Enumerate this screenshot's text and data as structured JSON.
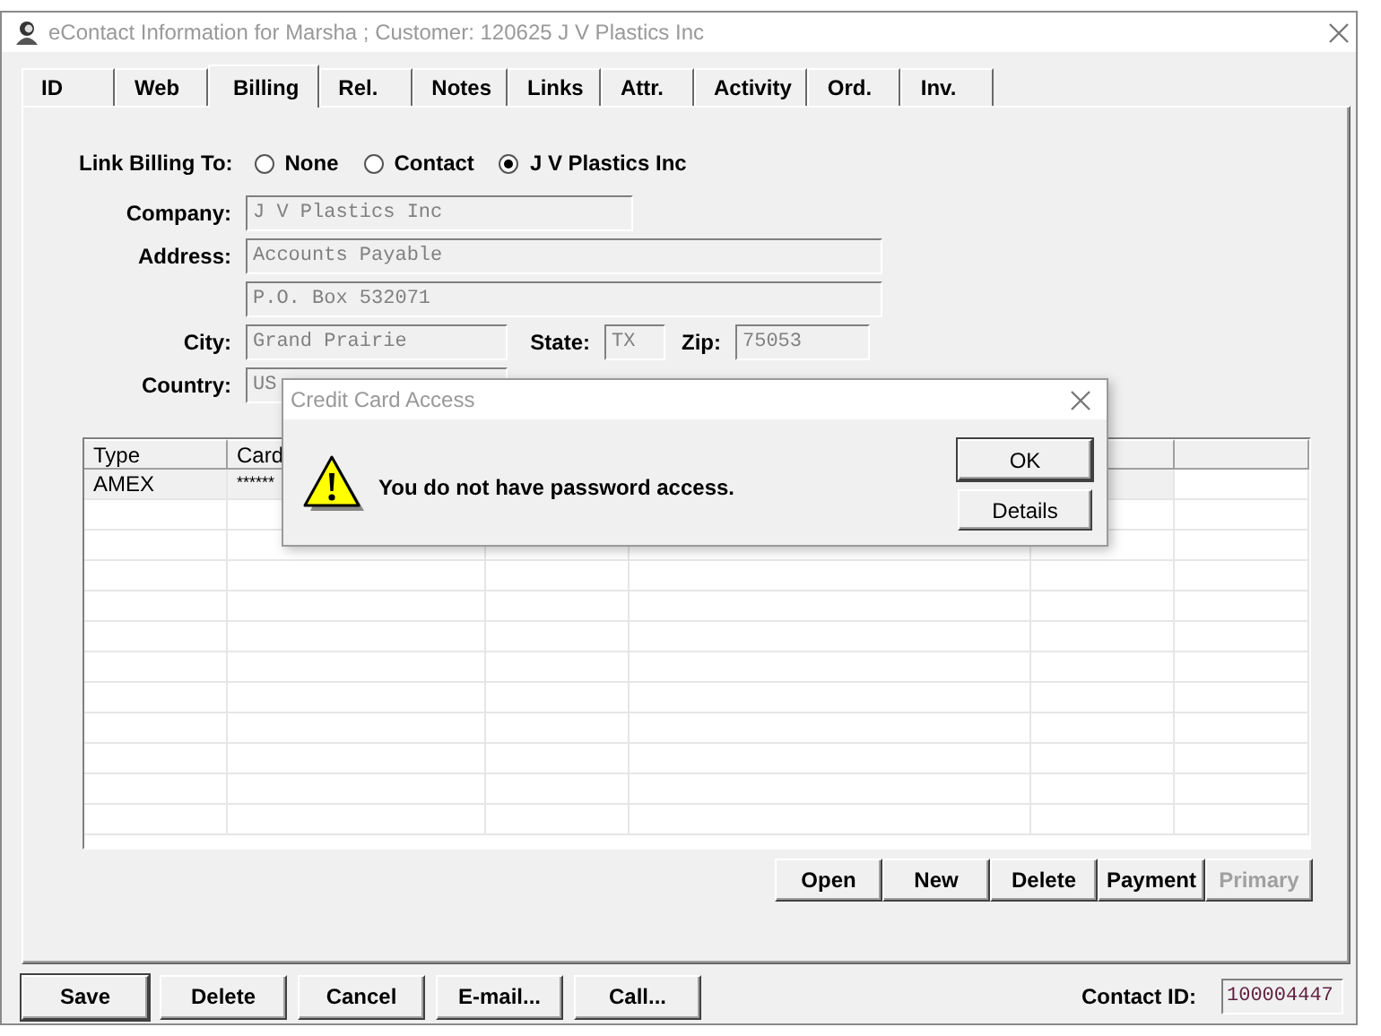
{
  "window": {
    "title": "eContact Information for Marsha ; Customer: 120625 J V Plastics Inc"
  },
  "tabs": [
    {
      "label": "ID",
      "selected": false
    },
    {
      "label": "Web",
      "selected": false
    },
    {
      "label": "Billing",
      "selected": true
    },
    {
      "label": "Rel.",
      "selected": false
    },
    {
      "label": "Notes",
      "selected": false
    },
    {
      "label": "Links",
      "selected": false
    },
    {
      "label": "Attr.",
      "selected": false
    },
    {
      "label": "Activity",
      "selected": false
    },
    {
      "label": "Ord.",
      "selected": false
    },
    {
      "label": "Inv.",
      "selected": false
    }
  ],
  "link_billing": {
    "label": "Link Billing To:",
    "options": [
      {
        "label": "None",
        "selected": false
      },
      {
        "label": "Contact",
        "selected": false
      },
      {
        "label": "J V Plastics Inc",
        "selected": true
      }
    ]
  },
  "address_form": {
    "company": {
      "label": "Company:",
      "value": "J V Plastics Inc"
    },
    "address": {
      "label": "Address:",
      "lines": [
        "Accounts Payable",
        "P.O. Box 532071"
      ]
    },
    "city": {
      "label": "City:",
      "value": "Grand Prairie"
    },
    "state": {
      "label": "State:",
      "value": "TX"
    },
    "zip": {
      "label": "Zip:",
      "value": "75053"
    },
    "country": {
      "label": "Country:",
      "value": "US"
    }
  },
  "cards_table": {
    "columns": [
      "Type",
      "Card"
    ],
    "rows": [
      [
        "AMEX",
        "******"
      ]
    ]
  },
  "card_buttons": [
    {
      "label": "Open",
      "disabled": false
    },
    {
      "label": "New",
      "disabled": false
    },
    {
      "label": "Delete",
      "disabled": false
    },
    {
      "label": "Payment",
      "disabled": false
    },
    {
      "label": "Primary",
      "disabled": true
    }
  ],
  "footer": {
    "buttons": [
      {
        "label": "Save",
        "default": true
      },
      {
        "label": "Delete",
        "default": false
      },
      {
        "label": "Cancel",
        "default": false
      },
      {
        "label": "E-mail...",
        "default": false
      },
      {
        "label": "Call...",
        "default": false
      }
    ],
    "contact_id": {
      "label": "Contact ID:",
      "value": "100004447"
    }
  },
  "dialog": {
    "title": "Credit Card Access",
    "message": "You do not have password access.",
    "buttons": [
      {
        "label": "OK",
        "default": true
      },
      {
        "label": "Details",
        "default": false
      }
    ]
  }
}
